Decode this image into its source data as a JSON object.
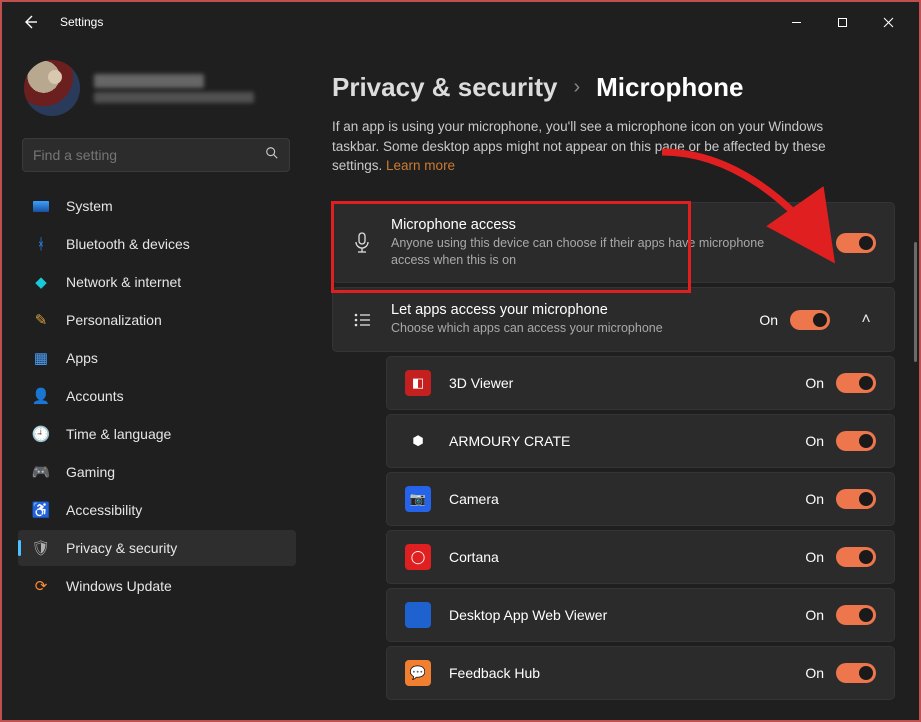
{
  "window": {
    "title": "Settings"
  },
  "search": {
    "placeholder": "Find a setting"
  },
  "sidebar": {
    "items": [
      {
        "label": "System"
      },
      {
        "label": "Bluetooth & devices"
      },
      {
        "label": "Network & internet"
      },
      {
        "label": "Personalization"
      },
      {
        "label": "Apps"
      },
      {
        "label": "Accounts"
      },
      {
        "label": "Time & language"
      },
      {
        "label": "Gaming"
      },
      {
        "label": "Accessibility"
      },
      {
        "label": "Privacy & security"
      },
      {
        "label": "Windows Update"
      }
    ]
  },
  "breadcrumb": {
    "parent": "Privacy & security",
    "current": "Microphone"
  },
  "intro_text": "If an app is using your microphone, you'll see a microphone icon on your Windows taskbar. Some desktop apps might not appear on this page or be affected by these settings.  ",
  "learn_more": "Learn more",
  "mic_access": {
    "title": "Microphone access",
    "desc": "Anyone using this device can choose if their apps have microphone access when this is on",
    "state_label": "On"
  },
  "let_apps": {
    "title": "Let apps access your microphone",
    "desc": "Choose which apps can access your microphone",
    "state_label": "On"
  },
  "apps": [
    {
      "name": "3D Viewer",
      "state_label": "On",
      "icon_bg": "#c52020",
      "glyph": "◧"
    },
    {
      "name": "ARMOURY CRATE",
      "state_label": "On",
      "icon_bg": "#2b2b2b",
      "glyph": "⬢"
    },
    {
      "name": "Camera",
      "state_label": "On",
      "icon_bg": "#2563eb",
      "glyph": "📷"
    },
    {
      "name": "Cortana",
      "state_label": "On",
      "icon_bg": "#e02020",
      "glyph": "◯"
    },
    {
      "name": "Desktop App Web Viewer",
      "state_label": "On",
      "icon_bg": "#1e62d0",
      "glyph": ""
    },
    {
      "name": "Feedback Hub",
      "state_label": "On",
      "icon_bg": "#f08030",
      "glyph": "💬"
    }
  ],
  "accent_color": "#ed764d"
}
